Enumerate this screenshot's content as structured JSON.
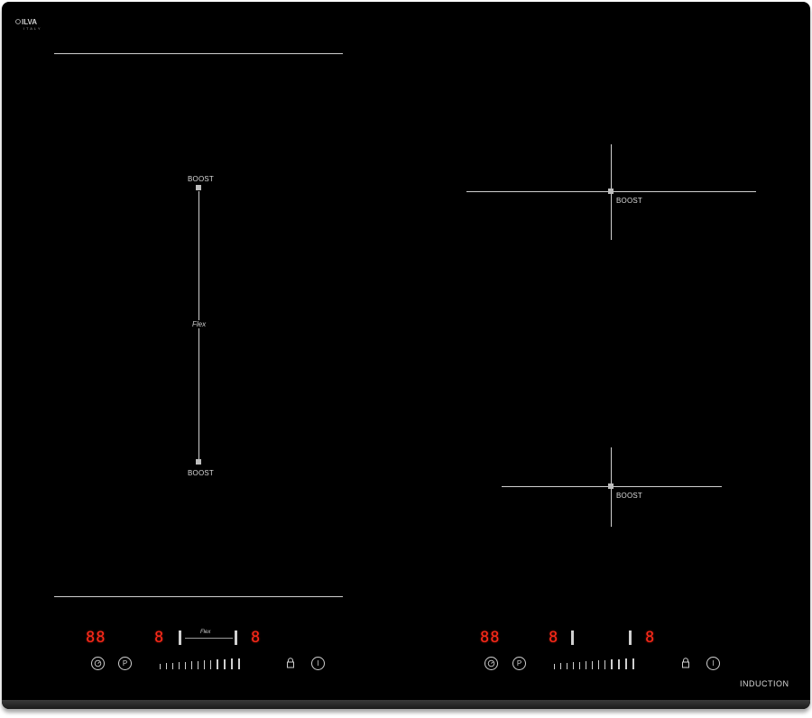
{
  "brand": {
    "name": "ILVA",
    "tagline": "ITALY"
  },
  "footer": {
    "label": "INDUCTION"
  },
  "zones": {
    "flex": {
      "boost_top": "BOOST",
      "boost_bottom": "BOOST",
      "center_label": "Flex"
    },
    "right_top": {
      "boost": "BOOST"
    },
    "right_bottom": {
      "boost": "BOOST"
    }
  },
  "panels": {
    "left": {
      "timer_display": "88",
      "zone_left_display": "8",
      "zone_right_display": "8",
      "bridge_label": "Flex",
      "timer_icon": "timer-icon",
      "pause_label": "P",
      "power_label": "I",
      "lock_icon": "lock-icon"
    },
    "right": {
      "timer_display": "88",
      "zone_left_display": "8",
      "zone_right_display": "8",
      "timer_icon": "timer-icon",
      "pause_label": "P",
      "power_label": "I",
      "lock_icon": "lock-icon"
    }
  },
  "colors": {
    "glass": "#000000",
    "display": "#ff2a1a",
    "print": "#cfcfcf"
  }
}
